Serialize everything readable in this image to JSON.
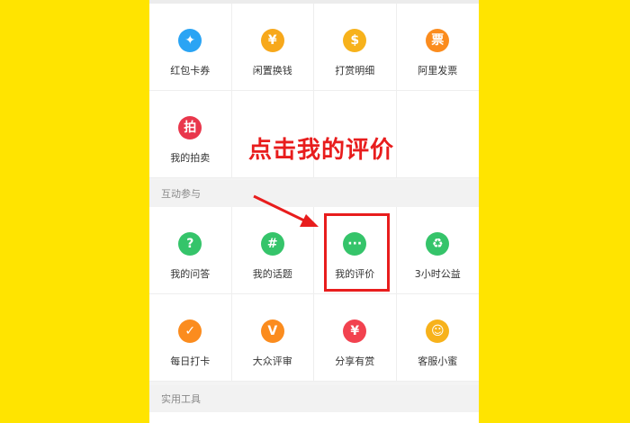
{
  "sections": {
    "interaction_title": "互动参与",
    "tools_title": "实用工具"
  },
  "grid1": [
    {
      "label": "红包卡券",
      "icon": "ticket-icon",
      "color": "#2aa4f4",
      "glyph": "✦"
    },
    {
      "label": "闲置换钱",
      "icon": "yuan-coin-icon",
      "color": "#f7a81b",
      "glyph": "¥"
    },
    {
      "label": "打赏明细",
      "icon": "reward-coin-icon",
      "color": "#f7b21b",
      "glyph": "$"
    },
    {
      "label": "阿里发票",
      "icon": "invoice-icon",
      "color": "#fb8c1e",
      "glyph": "票"
    }
  ],
  "grid1b": [
    {
      "label": "我的拍卖",
      "icon": "auction-icon",
      "color": "#e9374c",
      "glyph": "拍"
    }
  ],
  "grid2": [
    {
      "label": "我的问答",
      "icon": "qa-icon",
      "color": "#35c46a",
      "glyph": "?"
    },
    {
      "label": "我的话题",
      "icon": "topic-icon",
      "color": "#35c46a",
      "glyph": "#"
    },
    {
      "label": "我的评价",
      "icon": "review-icon",
      "color": "#35c46a",
      "glyph": "···"
    },
    {
      "label": "3小时公益",
      "icon": "charity-icon",
      "color": "#35c46a",
      "glyph": "♻"
    }
  ],
  "grid3": [
    {
      "label": "每日打卡",
      "icon": "checkin-calendar-icon",
      "color": "#fb8c1e",
      "glyph": "✓"
    },
    {
      "label": "大众评审",
      "icon": "jury-icon",
      "color": "#fb8c1e",
      "glyph": "V"
    },
    {
      "label": "分享有赏",
      "icon": "money-bag-icon",
      "color": "#f2424f",
      "glyph": "¥"
    },
    {
      "label": "客服小蜜",
      "icon": "service-bot-icon",
      "color": "#f7b21b",
      "glyph": "☺"
    }
  ],
  "annotation": "点击我的评价",
  "colors": {
    "background": "#FFE400",
    "annotation_red": "#e81d1d",
    "icon_green": "#35c46a"
  }
}
